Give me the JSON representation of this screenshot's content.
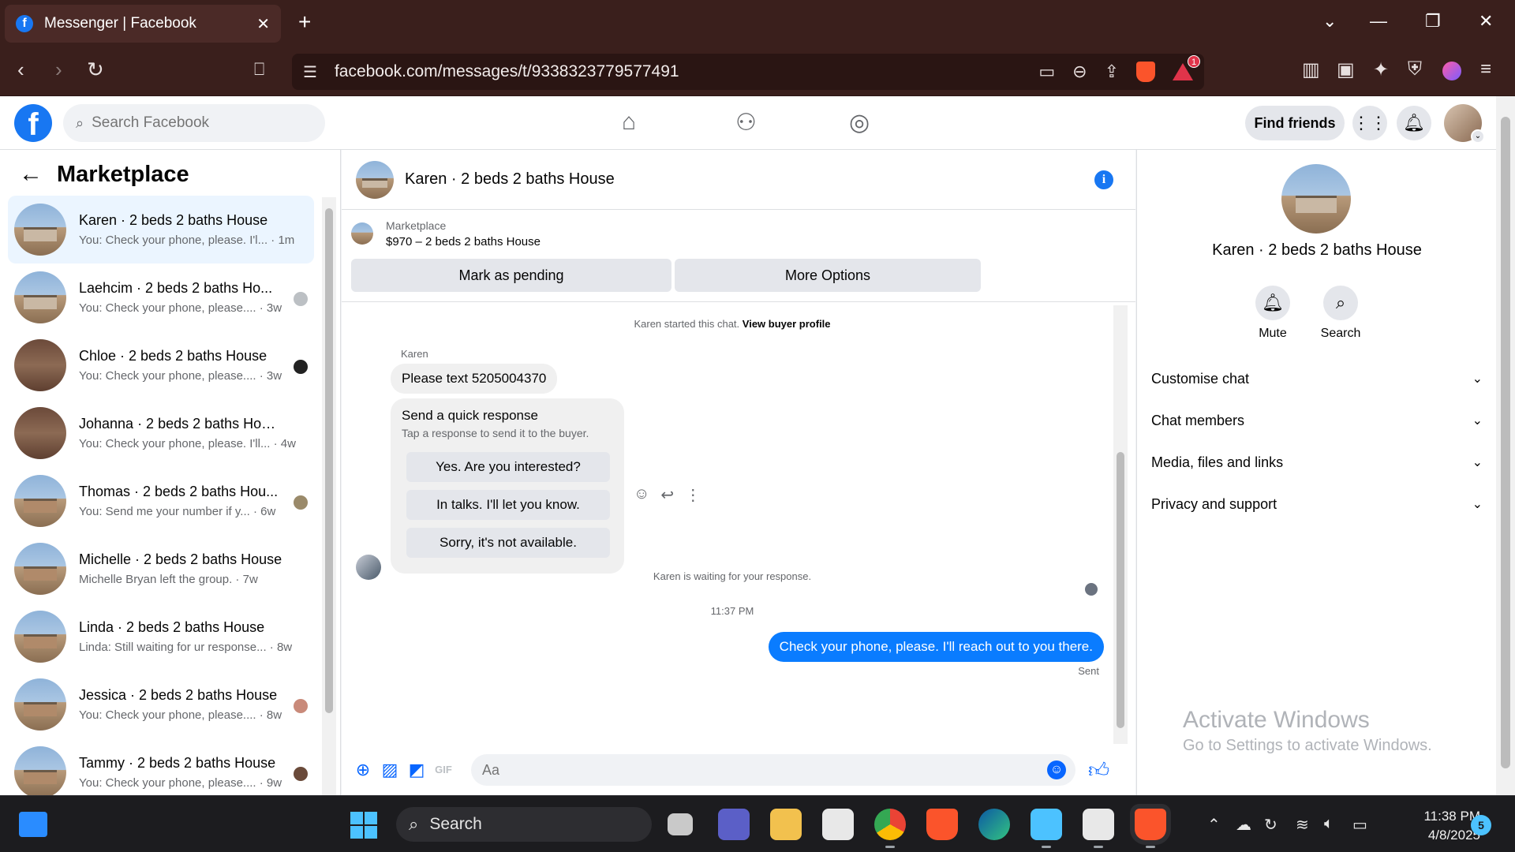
{
  "browser": {
    "tab_title": "Messenger | Facebook",
    "tab_close": "✕",
    "new_tab": "+",
    "url": "facebook.com/messages/t/9338323779577491",
    "bat_badge": "1"
  },
  "fb": {
    "search_placeholder": "Search Facebook",
    "find_friends": "Find friends"
  },
  "sidebar": {
    "title": "Marketplace",
    "chats": [
      {
        "name": "Karen · 2 beds 2 baths House",
        "snippet": "You: Check your phone, please. I'l... · 1m",
        "active": true
      },
      {
        "name": "Laehcim · 2 beds 2 baths Ho...",
        "snippet": "You: Check your phone, please.... · 3w"
      },
      {
        "name": "Chloe · 2 beds 2 baths House",
        "snippet": "You: Check your phone, please.... · 3w"
      },
      {
        "name": "Johanna · 2 beds 2 baths House",
        "snippet": "You: Check your phone, please. I'll... · 4w"
      },
      {
        "name": "Thomas · 2 beds 2 baths Hou...",
        "snippet": "You: Send me your number if y... · 6w"
      },
      {
        "name": "Michelle · 2 beds 2 baths House",
        "snippet": "Michelle Bryan left the group. · 7w"
      },
      {
        "name": "Linda · 2 beds 2 baths House",
        "snippet": "Linda: Still waiting for ur response... · 8w"
      },
      {
        "name": "Jessica · 2 beds 2 baths House",
        "snippet": "You: Check your phone, please.... · 8w"
      },
      {
        "name": "Tammy · 2 beds 2 baths House",
        "snippet": "You: Check your phone, please.... · 9w"
      }
    ]
  },
  "conversation": {
    "title": "Karen · 2 beds 2 baths House",
    "listing_label": "Marketplace",
    "listing_price": "$970 – 2 beds 2 baths House",
    "mark_pending": "Mark as pending",
    "more_options": "More Options",
    "started_text": "Karen started this chat.",
    "view_buyer": "View buyer profile",
    "sender_name": "Karen",
    "incoming_message": "Please text 5205004370",
    "quick_title": "Send a quick response",
    "quick_subtitle": "Tap a response to send it to the buyer.",
    "quick_options": [
      "Yes. Are you interested?",
      "In talks. I'll let you know.",
      "Sorry, it's not available."
    ],
    "waiting_text": "Karen is waiting for your response.",
    "timestamp": "11:37 PM",
    "outgoing_message": "Check your phone, please. I'll reach out to you there.",
    "sent_label": "Sent",
    "composer_placeholder": "Aa"
  },
  "info_panel": {
    "name": "Karen · 2 beds 2 baths House",
    "mute": "Mute",
    "search": "Search",
    "sections": [
      "Customise chat",
      "Chat members",
      "Media, files and links",
      "Privacy and support"
    ]
  },
  "watermark": {
    "line1": "Activate Windows",
    "line2": "Go to Settings to activate Windows."
  },
  "taskbar": {
    "search": "Search",
    "time": "11:38 PM",
    "date": "4/8/2025",
    "notifications": "5"
  }
}
